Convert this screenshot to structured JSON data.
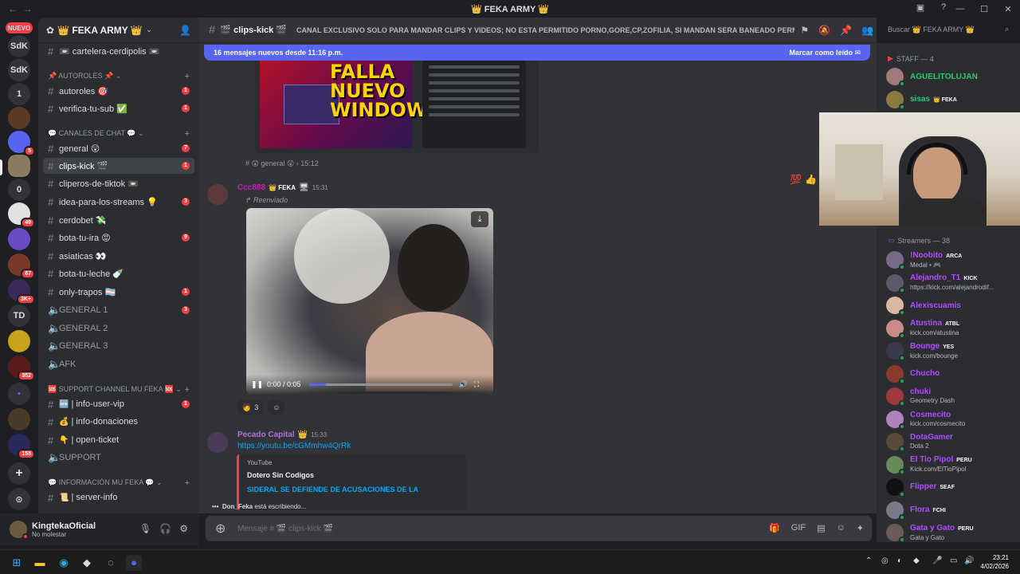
{
  "window": {
    "title": "👑 FEKA ARMY 👑",
    "back": "←",
    "forward": "→"
  },
  "rail": {
    "nuevo_label": "NUEVO",
    "servers": [
      "SdK",
      "SdK",
      "1",
      "",
      "",
      "",
      "",
      "0",
      "",
      "",
      "",
      "",
      "",
      "TD",
      "",
      "",
      "",
      "",
      ""
    ],
    "badges": {
      "s5": "5",
      "s9": "49",
      "s11": "67",
      "s12": "3K+",
      "s15": "352",
      "s18": "158"
    }
  },
  "sidebar": {
    "server_name": "👑 FEKA ARMY 👑",
    "top_channel": "📼 cartelera-cerdipolis 📼",
    "categories": {
      "autoroles": "📌 AUTOROLES 📌",
      "chat": "💬 CANALES DE CHAT 💬",
      "support": "🆘 SUPPORT CHANNEL MU FEKA 🆘",
      "info": "💬 INFORMACIÓN MU FEKA 💬"
    },
    "channels": [
      {
        "name": "autoroles 🎯",
        "emoji": "🎯",
        "unread": "1"
      },
      {
        "name": "verifica-tu-sub ✅",
        "emoji": "✅",
        "unread": "1"
      },
      {
        "name": "general 😲",
        "emoji": "😲",
        "unread": "7"
      },
      {
        "name": "clips-kick 🎬",
        "emoji": "🎬",
        "unread": "1"
      },
      {
        "name": "cliperos-de-tiktok 📼",
        "emoji": "📼",
        "unread": ""
      },
      {
        "name": "idea-para-los-streams 💡",
        "emoji": "💡",
        "unread": "3"
      },
      {
        "name": "cerdobet 💸",
        "emoji": "💸",
        "unread": ""
      },
      {
        "name": "bota-tu-ira 😡",
        "emoji": "😡",
        "unread": "9"
      },
      {
        "name": "asiaticas 👀",
        "emoji": "👀",
        "unread": ""
      },
      {
        "name": "bota-tu-leche 🍼",
        "emoji": "🍼",
        "unread": ""
      },
      {
        "name": "only-trapos 🏳️‍⚧️",
        "emoji": "🏳️",
        "unread": "1"
      }
    ],
    "voice": [
      "GENERAL 1",
      "GENERAL 2",
      "GENERAL 3",
      "AFK"
    ],
    "voice_unread": "3",
    "support_channels": [
      {
        "name": "| info-user-vip",
        "emoji": "🆕",
        "unread": "1"
      },
      {
        "name": "| info-donaciones",
        "emoji": "💰",
        "unread": ""
      },
      {
        "name": "| open-ticket",
        "emoji": "👇",
        "unread": ""
      }
    ],
    "support_voice": "SUPPORT",
    "info_channels": [
      {
        "name": "| server-info",
        "emoji": "📜"
      }
    ]
  },
  "user": {
    "name": "KingtekaOficial",
    "status": "No molestar"
  },
  "header": {
    "channel": "🎬 clips-kick 🎬",
    "topic": "CANAL EXCLUSIVO SOLO PARA MANDAR CLIPS Y VIDEOS; NO ESTA PERMITIDO PORNO,GORE,CP,ZOFILIA, SI MANDAN SERA BANEADO PERMA...",
    "search_placeholder": "Buscar 👑 FEKA ARMY 👑"
  },
  "chat": {
    "new_messages": "16 mensajes nuevos desde 11:16 p.m.",
    "mark_read": "Marcar como leído",
    "thumb_title": "FALLA NUEVO WINDOWS",
    "channel_ref": "# 😲 general 😲 › 15:12",
    "msg1": {
      "author": "Ccc888",
      "tag": "👑 FEKA",
      "time": "15:31",
      "forwarded": "↱ Reenviado"
    },
    "video": {
      "time": "0:00 / 0:05",
      "progress": 0.12
    },
    "reaction_count": "3",
    "msg2": {
      "author": "Pecado Capital",
      "time": "15:33",
      "link": "https://youtu.be/cGMmhw4QrRk",
      "embed_provider": "YouTube",
      "embed_title": "Dotero Sin Codigos",
      "embed_desc": "SIDERAL SE DEFIENDE DE ACUSACIONES DE LA"
    },
    "typing_user": "Don_Feka",
    "typing_text": "está escribiendo...",
    "composer_placeholder": "Mensaje # 🎬 clips-kick 🎬"
  },
  "members": {
    "staff_header": "STAFF — 4",
    "staff": [
      {
        "name": "AGUELITOLUJAN",
        "sub": "",
        "tag": "",
        "color": "#2dc770"
      },
      {
        "name": "sisas",
        "sub": "",
        "tag": "👑 FEKA",
        "color": "#2dc770"
      }
    ],
    "streamers_header": "Streamers — 38",
    "streamers": [
      {
        "name": "!Noobito",
        "tag": "ARCA",
        "sub": "Medal • 🎮",
        "color": "#b14dff"
      },
      {
        "name": "Alejandro_T1",
        "tag": "KICK",
        "sub": "https://kick.com/alejandrodif...",
        "color": "#b14dff"
      },
      {
        "name": "Alexiscuamis",
        "tag": "",
        "sub": "",
        "color": "#b14dff"
      },
      {
        "name": "Atustina",
        "tag": "ATBL",
        "sub": "kick.com/atustina",
        "color": "#b14dff"
      },
      {
        "name": "Bounge",
        "tag": "YES",
        "sub": "kick.com/bounge",
        "color": "#b14dff"
      },
      {
        "name": "Chucho",
        "tag": "",
        "sub": "",
        "color": "#b14dff"
      },
      {
        "name": "chuki",
        "tag": "",
        "sub": "Geometry Dash",
        "color": "#b14dff"
      },
      {
        "name": "Cosmecito",
        "tag": "",
        "sub": "kick.com/cosmecito",
        "color": "#b14dff"
      },
      {
        "name": "DotaGamer",
        "tag": "",
        "sub": "Dota 2",
        "color": "#b14dff"
      },
      {
        "name": "El Tio Pipol",
        "tag": "PERU",
        "sub": "Kick.com/ElTioPipol",
        "color": "#b14dff"
      },
      {
        "name": "Flipper",
        "tag": "SEAF",
        "sub": "",
        "color": "#b14dff"
      },
      {
        "name": "Flora",
        "tag": "FCHI",
        "sub": "",
        "color": "#b14dff"
      },
      {
        "name": "Gata y Gato",
        "tag": "PERU",
        "sub": "Gata y Gato",
        "color": "#b14dff"
      }
    ]
  },
  "taskbar": {
    "time": "23:21",
    "date": "4/02/2026"
  }
}
